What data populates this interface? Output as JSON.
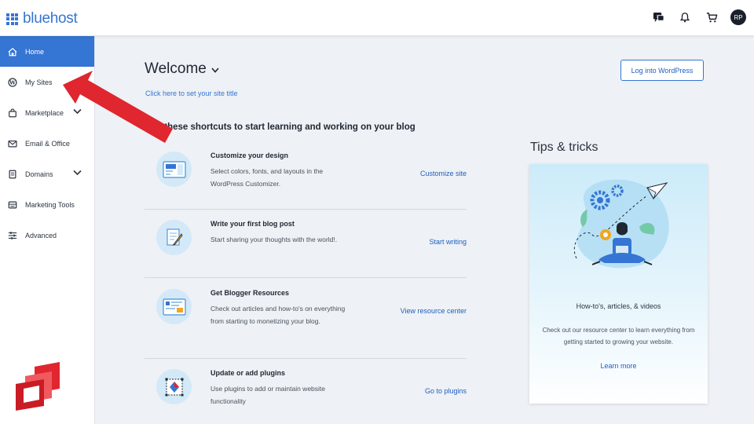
{
  "brand": {
    "name": "bluehost"
  },
  "topbar": {
    "icons": [
      "chat-icon",
      "bell-icon",
      "cart-icon"
    ],
    "avatar_initials": "RP"
  },
  "sidebar": {
    "items": [
      {
        "label": "Home",
        "icon": "home-icon",
        "active": true
      },
      {
        "label": "My Sites",
        "icon": "wordpress-icon"
      },
      {
        "label": "Marketplace",
        "icon": "shopping-bag-icon",
        "expandable": true
      },
      {
        "label": "Email & Office",
        "icon": "mail-icon"
      },
      {
        "label": "Domains",
        "icon": "domains-icon",
        "expandable": true
      },
      {
        "label": "Marketing Tools",
        "icon": "marketing-icon"
      },
      {
        "label": "Advanced",
        "icon": "sliders-icon"
      }
    ]
  },
  "main": {
    "welcome": "Welcome",
    "site_title_link": "Click here to set your site title",
    "wp_button": "Log into WordPress",
    "shortcuts_heading": "Use these shortcuts to start learning and working on your blog",
    "shortcuts": [
      {
        "title": "Customize your design",
        "desc": "Select colors, fonts, and layouts in the WordPress Customizer.",
        "link": "Customize site",
        "icon": "customize-icon"
      },
      {
        "title": "Write your first blog post",
        "desc": "Start sharing your thoughts with the world!.",
        "link": "Start writing",
        "icon": "write-icon"
      },
      {
        "title": "Get Blogger Resources",
        "desc": "Check out articles and how-to's on everything from starting to monetizing your blog.",
        "link": "View resource center",
        "icon": "resources-icon"
      },
      {
        "title": "Update or add plugins",
        "desc": "Use plugins to add or maintain website functionality",
        "link": "Go to plugins",
        "icon": "plugins-icon"
      }
    ]
  },
  "tips": {
    "heading": "Tips & tricks",
    "subtitle": "How-to's, articles, & videos",
    "desc": "Check out our resource center to learn everything from getting started to growing your website.",
    "link": "Learn more"
  },
  "colors": {
    "accent": "#3575d3",
    "arrow": "#e0262e",
    "background": "#eef1f5"
  }
}
